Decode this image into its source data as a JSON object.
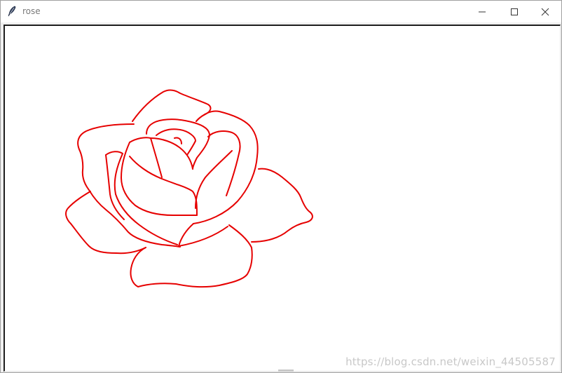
{
  "window": {
    "title": "rose",
    "icon": "feather-icon",
    "controls": {
      "minimize": "minimize-icon",
      "maximize": "maximize-icon",
      "close": "close-icon"
    }
  },
  "canvas": {
    "background": "#ffffff",
    "stroke_color": "#e60000",
    "drawing": "rose-outline"
  },
  "watermark": {
    "text": "https://blog.csdn.net/weixin_44505587"
  }
}
